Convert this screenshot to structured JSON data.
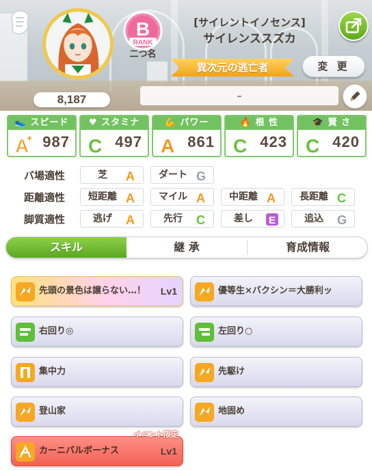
{
  "header": {
    "fans": "8,187",
    "rank": {
      "letter": "B",
      "word": "RANK",
      "subtitle": "二つ名"
    },
    "character": {
      "title": "[サイレントイノセンス]",
      "name": "サイレンススズカ"
    },
    "epithet": "異次元の逃亡者",
    "change_label": "変 更",
    "memo": "–"
  },
  "stats": [
    {
      "label": "スピード",
      "grade": "A+",
      "value": "987",
      "icon": "shoe-icon"
    },
    {
      "label": "スタミナ",
      "grade": "C",
      "value": "497",
      "icon": "heart-icon"
    },
    {
      "label": "パワー",
      "grade": "A",
      "value": "861",
      "icon": "arm-icon"
    },
    {
      "label": "根 性",
      "grade": "C",
      "value": "423",
      "icon": "flame-icon"
    },
    {
      "label": "賢 さ",
      "grade": "C",
      "value": "420",
      "icon": "graduation-cap-icon"
    }
  ],
  "aptitudes": {
    "track": {
      "label": "バ場適性",
      "items": [
        {
          "name": "芝",
          "grade": "A"
        },
        {
          "name": "ダート",
          "grade": "G"
        }
      ]
    },
    "distance": {
      "label": "距離適性",
      "items": [
        {
          "name": "短距離",
          "grade": "A"
        },
        {
          "name": "マイル",
          "grade": "A"
        },
        {
          "name": "中距離",
          "grade": "A"
        },
        {
          "name": "長距離",
          "grade": "C"
        }
      ]
    },
    "strategy": {
      "label": "脚質適性",
      "items": [
        {
          "name": "逃げ",
          "grade": "A"
        },
        {
          "name": "先行",
          "grade": "C"
        },
        {
          "name": "差し",
          "grade": "E"
        },
        {
          "name": "追込",
          "grade": "G"
        }
      ]
    }
  },
  "tabs": [
    {
      "label": "スキル",
      "active": true
    },
    {
      "label": "継 承",
      "active": false
    },
    {
      "label": "育成情報",
      "active": false
    }
  ],
  "skills": [
    {
      "name": "先頭の景色は譲らない…！",
      "level": "Lv1",
      "style": "gold",
      "icon": "speed-burst-icon"
    },
    {
      "name": "優等生×バクシン＝大勝利ッ",
      "level": "",
      "style": "normal",
      "icon": "speed-burst-icon"
    },
    {
      "name": "右回り◎",
      "level": "",
      "style": "normal",
      "icon": "track-direction-icon"
    },
    {
      "name": "左回り○",
      "level": "",
      "style": "normal",
      "icon": "track-direction-icon"
    },
    {
      "name": "集中力",
      "level": "",
      "style": "normal",
      "icon": "start-gate-icon"
    },
    {
      "name": "先駆け",
      "level": "",
      "style": "normal",
      "icon": "speed-burst-icon"
    },
    {
      "name": "登山家",
      "level": "",
      "style": "normal",
      "icon": "speed-burst-icon"
    },
    {
      "name": "地固め",
      "level": "",
      "style": "normal",
      "icon": "speed-burst-icon"
    },
    {
      "name": "カーニバルボーナス",
      "level": "Lv1",
      "style": "event",
      "tag": "イベント限定",
      "icon": "festival-icon"
    }
  ],
  "colors": {
    "grade_A": "#f49a1c",
    "grade_C": "#67c23a",
    "grade_E": "#b85fd6",
    "grade_G": "#9aa0a6",
    "stat_header": "#73c261",
    "tab_active": "#6bb92e",
    "epithet": "#f5b02a"
  }
}
